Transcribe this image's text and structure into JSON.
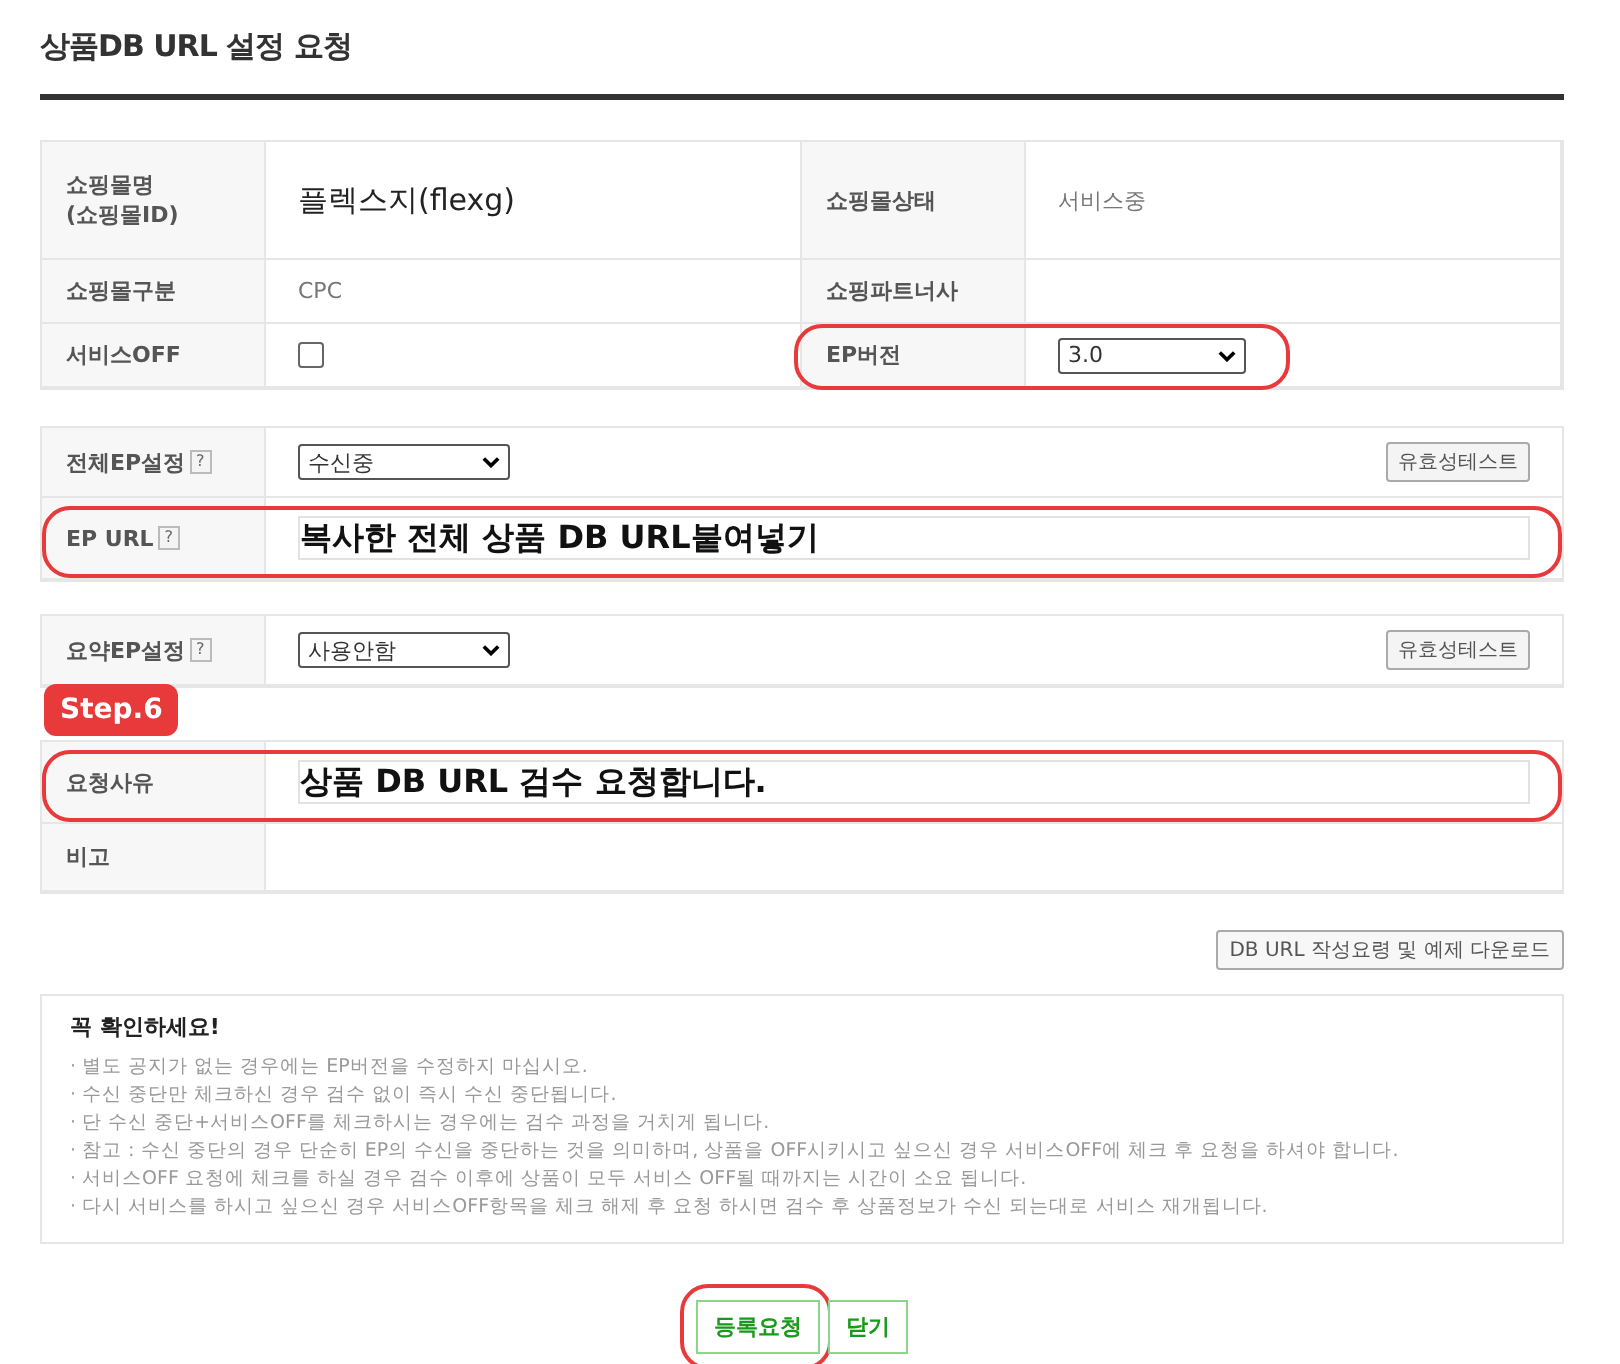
{
  "title": "상품DB URL 설정 요청",
  "shop_info": {
    "rows": [
      [
        {
          "label": [
            "쇼핑몰명",
            "(쇼핑몰ID)"
          ],
          "kind": "text",
          "value": "플렉스지(flexg)",
          "big": true,
          "highlighted": false
        },
        {
          "label": [
            "쇼핑몰상태"
          ],
          "kind": "text",
          "value": "서비스중",
          "big": false,
          "highlighted": false
        }
      ],
      [
        {
          "label": [
            "쇼핑몰구분"
          ],
          "kind": "text",
          "value": "CPC",
          "big": false,
          "highlighted": false
        },
        {
          "label": [
            "쇼핑파트너사"
          ],
          "kind": "empty",
          "highlighted": false
        }
      ],
      [
        {
          "label": [
            "서비스OFF"
          ],
          "kind": "checkbox",
          "checked": false,
          "highlighted": false
        },
        {
          "label": [
            "EP버전"
          ],
          "kind": "select",
          "value": "3.0",
          "highlighted": true
        }
      ]
    ]
  },
  "ep_settings": [
    {
      "label": "전체EP설정",
      "help": "?",
      "kind": "select",
      "value": "수신중",
      "button": "유효성테스트",
      "highlighted": false
    },
    {
      "label": "EP URL",
      "help": "?",
      "kind": "input",
      "value": "복사한 전체 상품 DB URL붙여넣기",
      "highlighted": true
    }
  ],
  "summary_settings": [
    {
      "label": "요약EP설정",
      "help": "?",
      "kind": "select",
      "value": "사용안함",
      "button": "유효성테스트",
      "highlighted": false
    }
  ],
  "step_badge": "Step.6",
  "request": [
    {
      "label": "요청사유",
      "kind": "input",
      "value": "상품 DB URL 검수 요청합니다.",
      "highlighted": true
    },
    {
      "label": "비고",
      "kind": "empty",
      "highlighted": false
    }
  ],
  "download_button": "DB URL 작성요령 및 예제 다운로드",
  "notice": {
    "title": "꼭 확인하세요!",
    "bullet": "·",
    "items": [
      "별도 공지가 없는 경우에는 EP버전을 수정하지 마십시오.",
      "수신 중단만 체크하신 경우 검수 없이 즉시 수신 중단됩니다.",
      "단 수신 중단+서비스OFF를 체크하시는 경우에는 검수 과정을 거치게 됩니다.",
      "참고 : 수신 중단의 경우 단순히 EP의 수신을 중단하는 것을 의미하며, 상품을 OFF시키시고 싶으신 경우 서비스OFF에 체크 후 요청을 하셔야 합니다.",
      "서비스OFF 요청에 체크를 하실 경우 검수 이후에 상품이 모두 서비스 OFF될 때까지는 시간이 소요 됩니다.",
      "다시 서비스를 하시고 싶으신 경우 서비스OFF항목을 체크 해제 후 요청 하시면 검수 후 상품정보가 수신 되는대로 서비스 재개됩니다."
    ]
  },
  "buttons": [
    {
      "label": "등록요청",
      "highlighted": true
    },
    {
      "label": "닫기",
      "highlighted": false
    }
  ]
}
